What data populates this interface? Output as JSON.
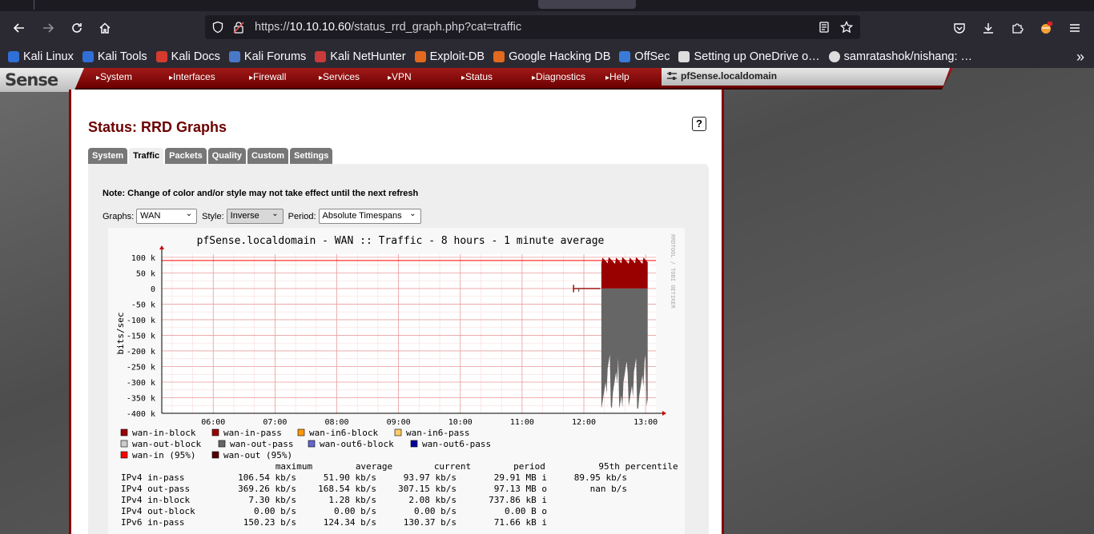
{
  "browser": {
    "url_prefix": "https://",
    "url_host": "10.10.10.60",
    "url_path": "/status_rrd_graph.php?cat=traffic",
    "bookmarks": [
      {
        "label": "Kali Linux",
        "icon": "kali-icon",
        "color": "#2f6fd6"
      },
      {
        "label": "Kali Tools",
        "icon": "kali-tools-icon",
        "color": "#2f6fd6"
      },
      {
        "label": "Kali Docs",
        "icon": "kali-docs-icon",
        "color": "#d63a2f"
      },
      {
        "label": "Kali Forums",
        "icon": "kali-forums-icon",
        "color": "#4a78c9"
      },
      {
        "label": "Kali NetHunter",
        "icon": "nethunter-icon",
        "color": "#c93a3a"
      },
      {
        "label": "Exploit-DB",
        "icon": "exploitdb-icon",
        "color": "#e2691e"
      },
      {
        "label": "Google Hacking DB",
        "icon": "ghdb-icon",
        "color": "#e2691e"
      },
      {
        "label": "OffSec",
        "icon": "offsec-icon",
        "color": "#3b7bd8"
      },
      {
        "label": "Setting up OneDrive o…",
        "icon": "onedrive-icon",
        "color": "#dddddd"
      },
      {
        "label": "samratashok/nishang: …",
        "icon": "github-icon",
        "color": "#dddddd"
      }
    ]
  },
  "pfsense": {
    "logo": "Sense",
    "menu": [
      "System",
      "Interfaces",
      "Firewall",
      "Services",
      "VPN",
      "Status",
      "Diagnostics",
      "Help"
    ],
    "hostname": "pfSense.localdomain",
    "title": "Status: RRD Graphs",
    "help": "?",
    "tabs": [
      "System",
      "Traffic",
      "Packets",
      "Quality",
      "Custom",
      "Settings"
    ],
    "active_tab": "Traffic",
    "note": "Note: Change of color and/or style may not take effect until the next refresh",
    "graphs_label": "Graphs:",
    "graphs_value": "WAN",
    "style_label": "Style:",
    "style_value": "Inverse",
    "period_label": "Period:",
    "period_value": "Absolute Timespans"
  },
  "chart_data": {
    "type": "area",
    "title": "pfSense.localdomain - WAN :: Traffic - 8 hours - 1 minute average",
    "ylabel": "bits/sec",
    "side_label": "RRDTOOL / TOBI OETIKER",
    "yticks": [
      "100 k",
      "50 k",
      "0",
      "-50 k",
      "-100 k",
      "-150 k",
      "-200 k",
      "-250 k",
      "-300 k",
      "-350 k",
      "-400 k"
    ],
    "ytick_values": [
      100000,
      50000,
      0,
      -50000,
      -100000,
      -150000,
      -200000,
      -250000,
      -300000,
      -350000,
      -400000
    ],
    "ylim": [
      -400000,
      100000
    ],
    "xticks": [
      "06:00",
      "07:00",
      "08:00",
      "09:00",
      "10:00",
      "11:00",
      "12:00",
      "13:00"
    ],
    "grid": true,
    "in_95th_value": 89950,
    "series": [
      {
        "name": "wan-in-pass",
        "color": "#990000",
        "x_start": "12:17",
        "x_end": "13:02",
        "approx_level": 90000
      },
      {
        "name": "wan-out-pass",
        "color": "#666666",
        "x_start": "12:17",
        "x_end": "13:02",
        "approx_level": -300000
      }
    ],
    "legend": [
      {
        "name": "wan-in-block",
        "color": "#990000"
      },
      {
        "name": "wan-in-pass",
        "color": "#990000"
      },
      {
        "name": "wan-in6-block",
        "color": "#ff9900"
      },
      {
        "name": "wan-in6-pass",
        "color": "#ffcc66"
      },
      {
        "name": "wan-out-block",
        "color": "#cccccc"
      },
      {
        "name": "wan-out-pass",
        "color": "#666666"
      },
      {
        "name": "wan-out6-block",
        "color": "#6666cc"
      },
      {
        "name": "wan-out6-pass",
        "color": "#000099"
      },
      {
        "name": "wan-in (95%)",
        "color": "#ff0000"
      },
      {
        "name": "wan-out (95%)",
        "color": "#550000"
      }
    ],
    "table_header": [
      "maximum",
      "average",
      "current",
      "period",
      "95th percentile"
    ],
    "table_rows": [
      {
        "label": "IPv4 in-pass",
        "maximum": "106.54 kb/s",
        "average": "51.90 kb/s",
        "current": "93.97 kb/s",
        "period": "29.91 MB i",
        "p95": "89.95 kb/s"
      },
      {
        "label": "IPv4 out-pass",
        "maximum": "369.26 kb/s",
        "average": "168.54 kb/s",
        "current": "307.15 kb/s",
        "period": "97.13 MB o",
        "p95": "nan  b/s"
      },
      {
        "label": "IPv4 in-block",
        "maximum": "7.30 kb/s",
        "average": "1.28 kb/s",
        "current": "2.08 kb/s",
        "period": "737.86 kB i",
        "p95": ""
      },
      {
        "label": "IPv4 out-block",
        "maximum": "0.00  b/s",
        "average": "0.00  b/s",
        "current": "0.00  b/s",
        "period": "0.00  B o",
        "p95": ""
      },
      {
        "label": "IPv6 in-pass",
        "maximum": "150.23  b/s",
        "average": "124.34  b/s",
        "current": "130.37  b/s",
        "period": "71.66 kB i",
        "p95": ""
      }
    ]
  }
}
